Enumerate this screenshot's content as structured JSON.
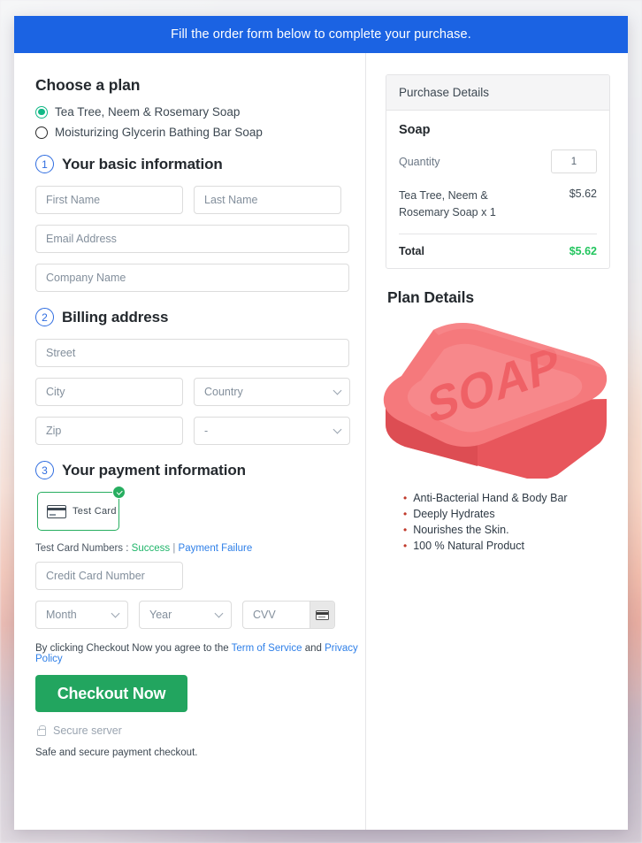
{
  "banner": {
    "message": "Fill the order form below to complete your purchase."
  },
  "plan": {
    "heading": "Choose a plan",
    "options": [
      {
        "label": "Tea Tree, Neem & Rosemary Soap",
        "selected": true
      },
      {
        "label": "Moisturizing Glycerin Bathing Bar Soap",
        "selected": false
      }
    ]
  },
  "steps": {
    "basic": {
      "number": "1",
      "title": "Your basic information"
    },
    "billing": {
      "number": "2",
      "title": "Billing address"
    },
    "payment": {
      "number": "3",
      "title": "Your payment information"
    }
  },
  "basic_fields": {
    "first_name": {
      "placeholder": "First Name",
      "value": ""
    },
    "last_name": {
      "placeholder": "Last Name",
      "value": ""
    },
    "email": {
      "placeholder": "Email Address",
      "value": ""
    },
    "company": {
      "placeholder": "Company Name",
      "value": ""
    }
  },
  "billing_fields": {
    "street": {
      "placeholder": "Street",
      "value": ""
    },
    "city": {
      "placeholder": "City",
      "value": ""
    },
    "country": {
      "placeholder": "Country",
      "value": ""
    },
    "zip": {
      "placeholder": "Zip",
      "value": ""
    },
    "state": {
      "placeholder": "-",
      "value": ""
    }
  },
  "payment": {
    "tile_label": "Test Card",
    "test_numbers_prefix": "Test Card Numbers :",
    "success_link": "Success",
    "separator": "|",
    "failure_link": "Payment Failure",
    "card_number": {
      "placeholder": "Credit Card Number",
      "value": ""
    },
    "month": {
      "placeholder": "Month",
      "value": ""
    },
    "year": {
      "placeholder": "Year",
      "value": ""
    },
    "cvv": {
      "placeholder": "CVV",
      "value": ""
    }
  },
  "agreement": {
    "prefix": "By clicking Checkout Now you agree to the",
    "terms_link": "Term of Service",
    "conjunction": "and",
    "privacy_link": "Privacy Policy"
  },
  "checkout": {
    "button_label": "Checkout Now",
    "secure_label": "Secure server",
    "safe_note": "Safe and secure payment checkout."
  },
  "purchase_details": {
    "header": "Purchase Details",
    "product_name": "Soap",
    "quantity_label": "Quantity",
    "quantity_value": "1",
    "line_item": "Tea Tree, Neem & Rosemary Soap x 1",
    "line_price": "$5.62",
    "total_label": "Total",
    "total_value": "$5.62"
  },
  "plan_details": {
    "heading": "Plan Details",
    "image_label": "SOAP",
    "features": [
      "Anti-Bacterial Hand & Body Bar",
      "Deeply Hydrates",
      "Nourishes the Skin.",
      "100 % Natural Product"
    ]
  },
  "colors": {
    "banner_blue": "#1b63e3",
    "step_blue": "#2e6ce0",
    "checkout_green": "#22a55f",
    "total_green": "#22c55e",
    "radio_green": "#12b886",
    "soap_top": "#f5797c",
    "soap_side": "#e8565c",
    "soap_inset": "#f7888b"
  }
}
